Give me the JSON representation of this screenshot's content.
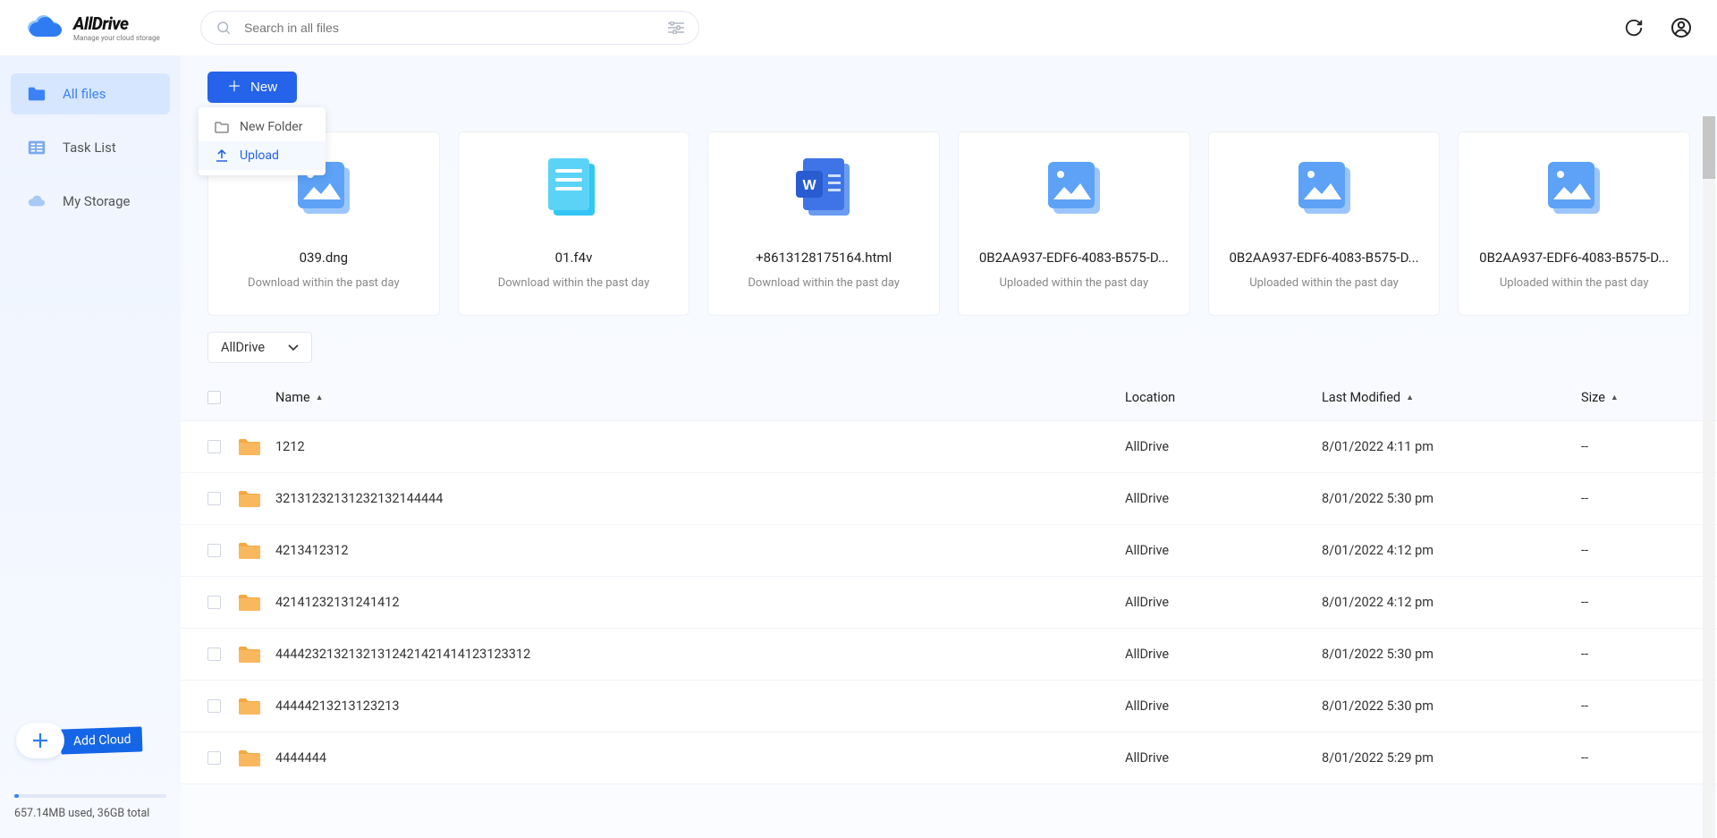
{
  "brand": {
    "title": "AllDrive",
    "subtitle": "Manage your cloud storage"
  },
  "search": {
    "placeholder": "Search in all files"
  },
  "sidebar": {
    "items": [
      {
        "label": "All files"
      },
      {
        "label": "Task List"
      },
      {
        "label": "My Storage"
      }
    ],
    "addcloud_label": "Add Cloud",
    "storage_text": "657.14MB used, 36GB total"
  },
  "newbtn": {
    "label": "New"
  },
  "dropdown": {
    "new_folder": "New Folder",
    "upload": "Upload"
  },
  "recent": [
    {
      "name": "039.dng",
      "sub": "Download within the past day",
      "type": "image"
    },
    {
      "name": "01.f4v",
      "sub": "Download within the past day",
      "type": "doc"
    },
    {
      "name": "+8613128175164.html",
      "sub": "Download within the past day",
      "type": "word"
    },
    {
      "name": "0B2AA937-EDF6-4083-B575-D...",
      "sub": "Uploaded within the past day",
      "type": "image"
    },
    {
      "name": "0B2AA937-EDF6-4083-B575-D...",
      "sub": "Uploaded within the past day",
      "type": "image"
    },
    {
      "name": "0B2AA937-EDF6-4083-B575-D...",
      "sub": "Uploaded within the past day",
      "type": "image"
    }
  ],
  "breadcrumb": {
    "selected": "AllDrive"
  },
  "table": {
    "headers": {
      "name": "Name",
      "location": "Location",
      "modified": "Last Modified",
      "size": "Size"
    },
    "rows": [
      {
        "name": "1212",
        "location": "AllDrive",
        "modified": "8/01/2022 4:11 pm",
        "size": "--",
        "type": "folder"
      },
      {
        "name": "32131232131232132144444",
        "location": "AllDrive",
        "modified": "8/01/2022 5:30 pm",
        "size": "--",
        "type": "folder"
      },
      {
        "name": "4213412312",
        "location": "AllDrive",
        "modified": "8/01/2022 4:12 pm",
        "size": "--",
        "type": "folder"
      },
      {
        "name": "42141232131241412",
        "location": "AllDrive",
        "modified": "8/01/2022 4:12 pm",
        "size": "--",
        "type": "folder"
      },
      {
        "name": "44442321321321312421421414123123312",
        "location": "AllDrive",
        "modified": "8/01/2022 5:30 pm",
        "size": "--",
        "type": "folder"
      },
      {
        "name": "44444213213123213",
        "location": "AllDrive",
        "modified": "8/01/2022 5:30 pm",
        "size": "--",
        "type": "folder"
      },
      {
        "name": "4444444",
        "location": "AllDrive",
        "modified": "8/01/2022 5:29 pm",
        "size": "--",
        "type": "folder"
      }
    ]
  }
}
